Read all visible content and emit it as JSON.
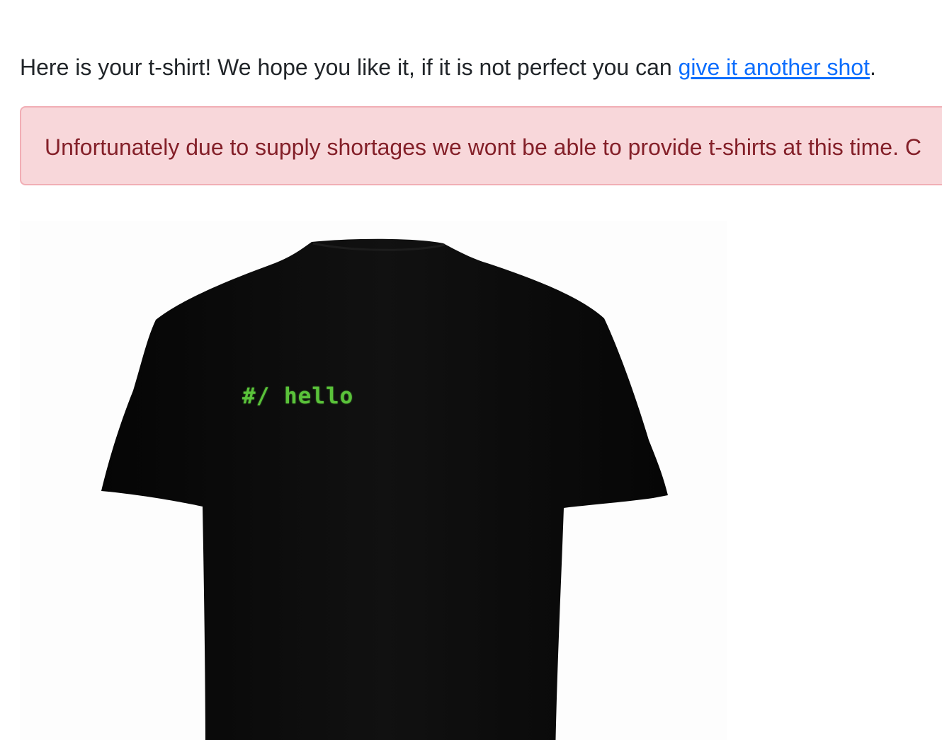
{
  "intro": {
    "text_before": "Here is your t-shirt! We hope you like it, if it is not perfect you can ",
    "link_label": "give it another shot",
    "text_after": "."
  },
  "alert": {
    "message": "Unfortunately due to supply shortages we wont be able to provide t-shirts at this time. C"
  },
  "tshirt": {
    "print_text": "#/ hello",
    "shirt_color": "#0b0b0b",
    "print_color": "#5ac23a"
  },
  "colors": {
    "link": "#0d6efd",
    "alert_background": "#f8d7da",
    "alert_border": "#f1aeb5",
    "alert_text": "#842029"
  }
}
